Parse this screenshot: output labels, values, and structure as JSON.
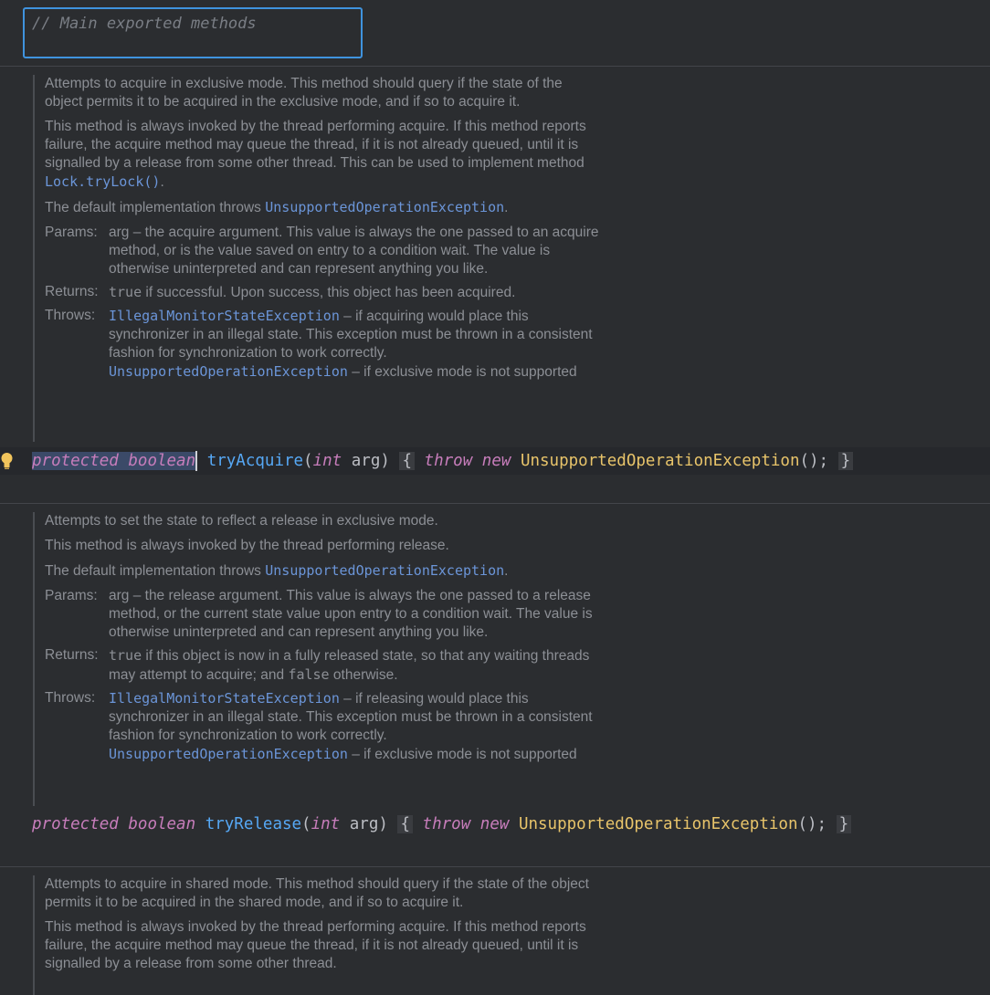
{
  "comment": "// Main exported methods",
  "doc1": {
    "p1": "Attempts to acquire in exclusive mode. This method should query if the state of the object permits it to be acquired in the exclusive mode, and if so to acquire it.",
    "p2a": "This method is always invoked by the thread performing acquire. If this method reports failure, the acquire method may queue the thread, if it is not already queued, until it is signalled by a release from some other thread. This can be used to implement method ",
    "p2code": "Lock.tryLock()",
    "p2b": ".",
    "p3a": "The default implementation throws ",
    "p3code": "UnsupportedOperationException",
    "p3b": ".",
    "params_label": "Params:",
    "params_text": "arg – the acquire argument. This value is always the one passed to an acquire method, or is the value saved on entry to a condition wait. The value is otherwise uninterpreted and can represent anything you like.",
    "returns_label": "Returns:",
    "returns_kw": "true",
    "returns_text": " if successful. Upon success, this object has been acquired.",
    "throws_label": "Throws:",
    "throws1_code": "IllegalMonitorStateException",
    "throws1_text": " – if acquiring would place this synchronizer in an illegal state. This exception must be thrown in a consistent fashion for synchronization to work correctly.",
    "throws2_code": "UnsupportedOperationException",
    "throws2_text": " – if exclusive mode is not supported"
  },
  "line1": {
    "protected": "protected",
    "boolean": "boolean",
    "name": "tryAcquire",
    "int": "int",
    "arg": "arg",
    "throw": "throw",
    "new": "new",
    "exception": "UnsupportedOperationException",
    "tail": "();"
  },
  "doc2": {
    "p1": "Attempts to set the state to reflect a release in exclusive mode.",
    "p2": "This method is always invoked by the thread performing release.",
    "p3a": "The default implementation throws ",
    "p3code": "UnsupportedOperationException",
    "p3b": ".",
    "params_label": "Params:",
    "params_text": "arg – the release argument. This value is always the one passed to a release method, or the current state value upon entry to a condition wait. The value is otherwise uninterpreted and can represent anything you like.",
    "returns_label": "Returns:",
    "returns_kw1": "true",
    "returns_text1": " if this object is now in a fully released state, so that any waiting threads may attempt to acquire; and ",
    "returns_kw2": "false",
    "returns_text2": " otherwise.",
    "throws_label": "Throws:",
    "throws1_code": "IllegalMonitorStateException",
    "throws1_text": " – if releasing would place this synchronizer in an illegal state. This exception must be thrown in a consistent fashion for synchronization to work correctly.",
    "throws2_code": "UnsupportedOperationException",
    "throws2_text": " – if exclusive mode is not supported"
  },
  "line2": {
    "protected": "protected",
    "boolean": "boolean",
    "name": "tryRelease",
    "int": "int",
    "arg": "arg",
    "throw": "throw",
    "new": "new",
    "exception": "UnsupportedOperationException",
    "tail": "();"
  },
  "doc3": {
    "p1": "Attempts to acquire in shared mode. This method should query if the state of the object permits it to be acquired in the shared mode, and if so to acquire it.",
    "p2": "This method is always invoked by the thread performing acquire. If this method reports failure, the acquire method may queue the thread, if it is not already queued, until it is signalled by a release from some other thread."
  }
}
